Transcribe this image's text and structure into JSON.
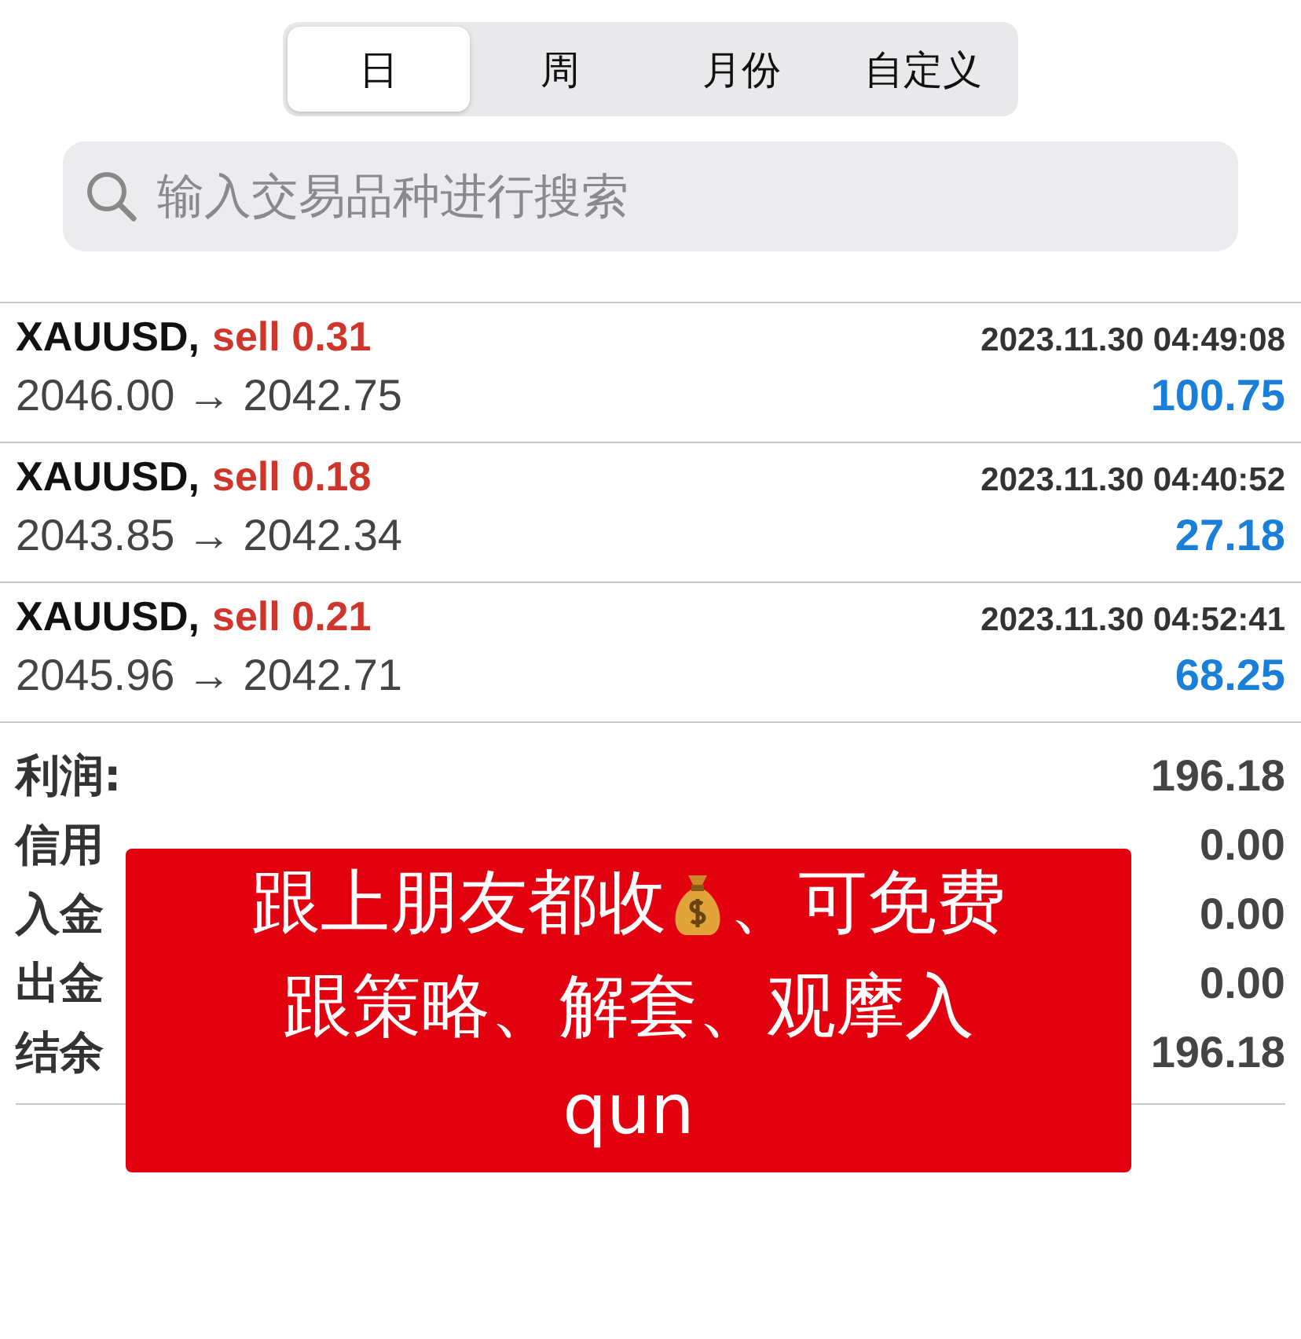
{
  "tabs": [
    {
      "label": "日",
      "selected": true
    },
    {
      "label": "周",
      "selected": false
    },
    {
      "label": "月份",
      "selected": false
    },
    {
      "label": "自定义",
      "selected": false
    }
  ],
  "search": {
    "placeholder": "输入交易品种进行搜索"
  },
  "trades": [
    {
      "symbol": "XAUUSD,",
      "order": "sell 0.31",
      "time": "2023.11.30 04:49:08",
      "prices": "2046.00 → 2042.75",
      "profit": "100.75"
    },
    {
      "symbol": "XAUUSD,",
      "order": "sell 0.18",
      "time": "2023.11.30 04:40:52",
      "prices": "2043.85 → 2042.34",
      "profit": "27.18"
    },
    {
      "symbol": "XAUUSD,",
      "order": "sell 0.21",
      "time": "2023.11.30 04:52:41",
      "prices": "2045.96 → 2042.71",
      "profit": "68.25"
    }
  ],
  "summary": [
    {
      "label": "利润:",
      "value": "196.18"
    },
    {
      "label": "信用",
      "value": "0.00"
    },
    {
      "label": "入金",
      "value": "0.00"
    },
    {
      "label": "出金",
      "value": "0.00"
    },
    {
      "label": "结余",
      "value": "196.18"
    }
  ],
  "banner": {
    "line1_before": "跟上朋友都收",
    "line1_after": "、可免费",
    "line2": "跟策略、解套、观摩入",
    "line3": "qun"
  }
}
